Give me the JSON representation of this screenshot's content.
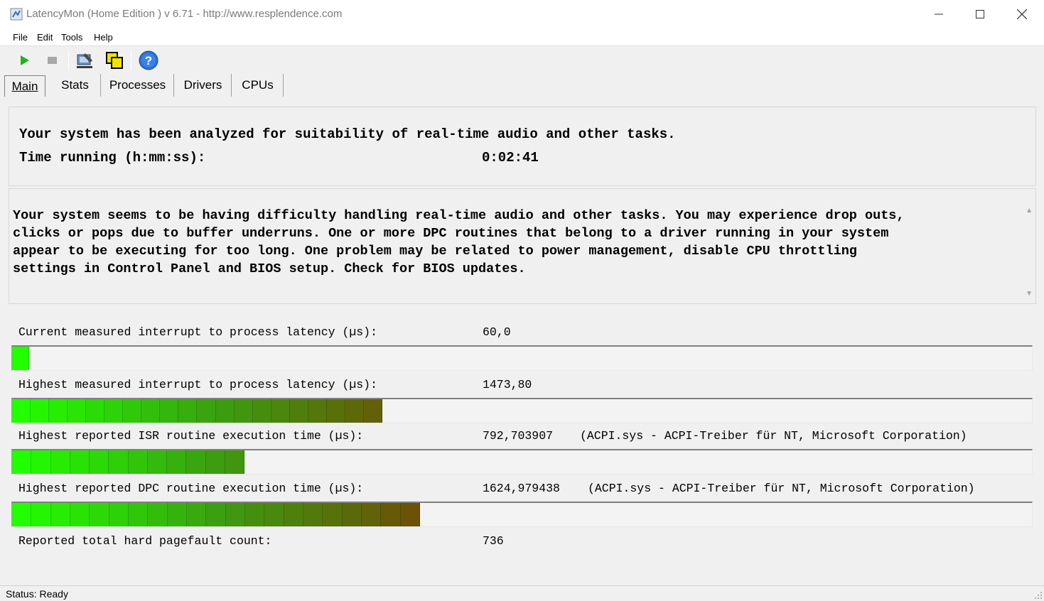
{
  "window": {
    "title": "LatencyMon  (Home Edition )  v 6.71 - http://www.resplendence.com"
  },
  "menu": [
    "File",
    "Edit",
    "Tools",
    "Help"
  ],
  "toolbar": {
    "icons": [
      "play-icon",
      "stop-icon",
      "settings-icon",
      "windows-icon",
      "help-icon"
    ]
  },
  "tabs": [
    "Main",
    "Stats",
    "Processes",
    "Drivers",
    "CPUs"
  ],
  "main": {
    "analyzed": "Your system has been analyzed for suitability of real-time audio and other tasks.",
    "time_label": "Time running (h:mm:ss):",
    "time_value": "0:02:41",
    "message": "Your system seems to be having difficulty handling real-time audio and other tasks. You may experience drop outs,\nclicks or pops due to buffer underruns. One or more DPC routines that belong to a driver running in your system\nappear to be executing for too long. One problem may be related to power management, disable CPU throttling\nsettings in Control Panel and BIOS setup. Check for BIOS updates."
  },
  "metrics": [
    {
      "label": "Current measured interrupt to process latency (µs):",
      "value": "60,0",
      "extra": "",
      "fill": 0.017,
      "segments": 1
    },
    {
      "label": "Highest measured interrupt to process latency (µs):",
      "value": "1473,80",
      "extra": "",
      "fill": 0.363,
      "segments": 20
    },
    {
      "label": "Highest reported ISR routine execution time (µs):",
      "value": "792,703907",
      "extra": "(ACPI.sys - ACPI-Treiber für NT, Microsoft Corporation)",
      "fill": 0.228,
      "segments": 12
    },
    {
      "label": "Highest reported DPC routine execution time (µs):",
      "value": "1624,979438",
      "extra": "(ACPI.sys - ACPI-Treiber für NT, Microsoft Corporation)",
      "fill": 0.4,
      "segments": 21
    }
  ],
  "pagefault": {
    "label": "Reported total hard pagefault count:",
    "value": "736"
  },
  "status": "Status: Ready",
  "colors": {
    "bar_start": "#22ff00",
    "bar_mid": "#3aa010",
    "bar_end": "#6b5207"
  }
}
